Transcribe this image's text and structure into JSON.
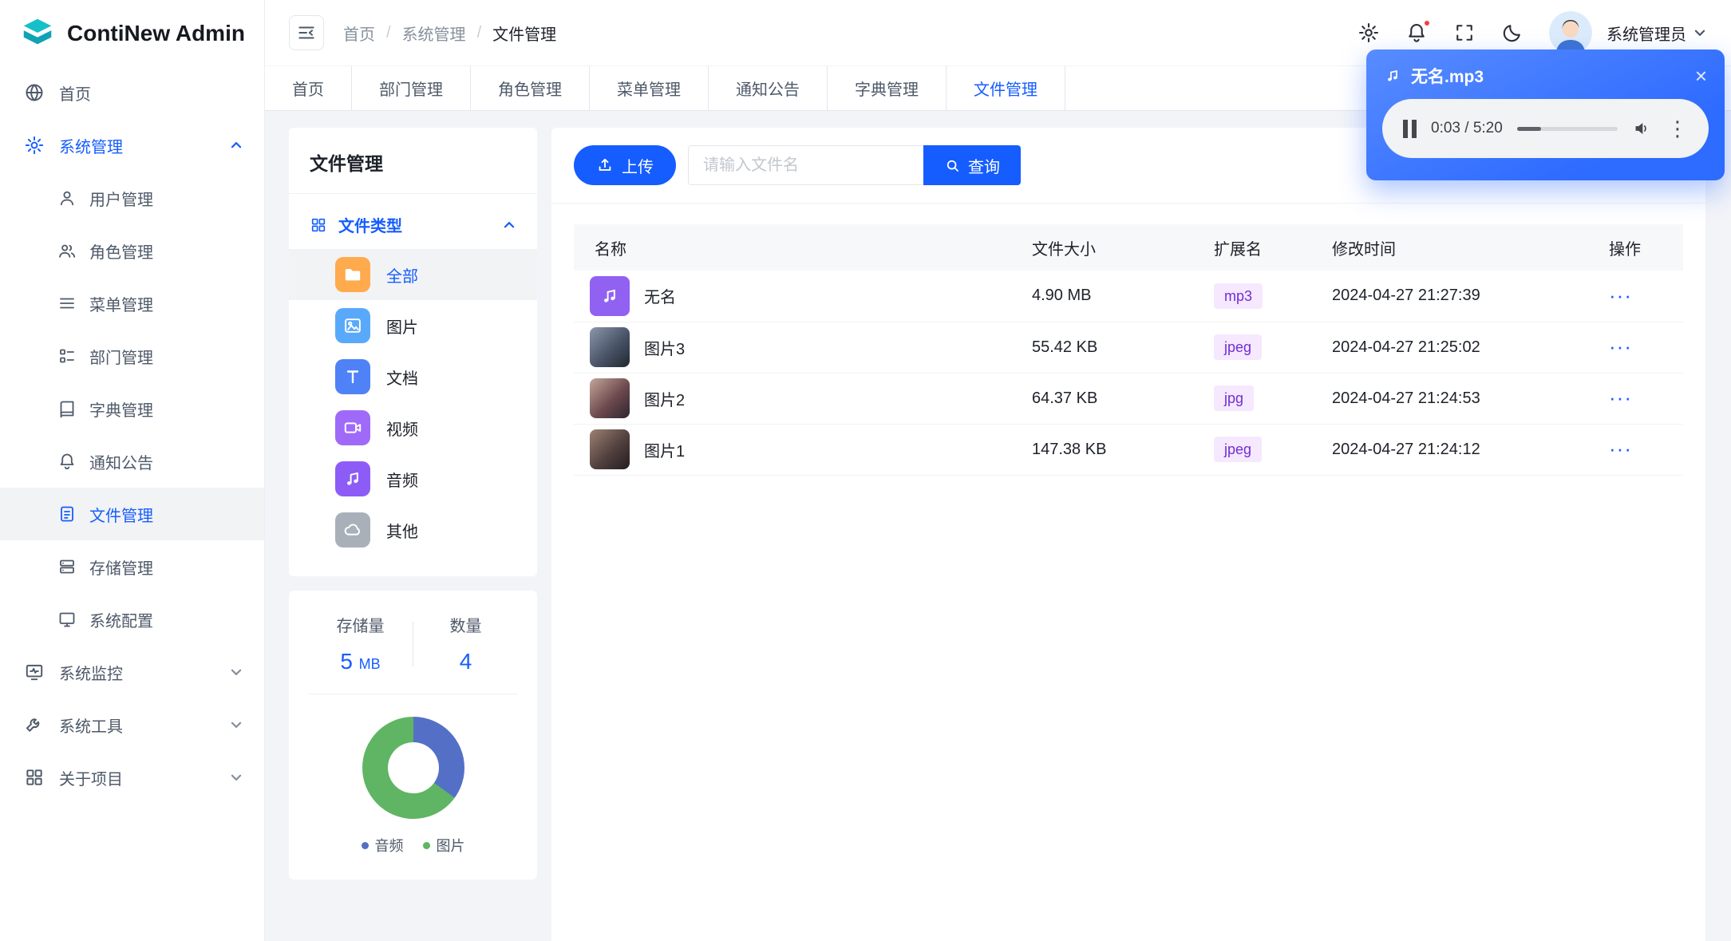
{
  "app": {
    "title": "ContiNew Admin"
  },
  "header": {
    "breadcrumb": {
      "items": [
        "首页",
        "系统管理",
        "文件管理"
      ],
      "separator": "/"
    },
    "user": {
      "name": "系统管理员"
    }
  },
  "tabs": {
    "items": [
      "首页",
      "部门管理",
      "角色管理",
      "菜单管理",
      "通知公告",
      "字典管理",
      "文件管理"
    ],
    "active": "文件管理"
  },
  "sidebar": {
    "home": "首页",
    "system": "系统管理",
    "system_children": [
      "用户管理",
      "角色管理",
      "菜单管理",
      "部门管理",
      "字典管理",
      "通知公告",
      "文件管理",
      "存储管理",
      "系统配置"
    ],
    "active_child": "文件管理",
    "monitor": "系统监控",
    "tools": "系统工具",
    "about": "关于项目"
  },
  "file_panel": {
    "title": "文件管理",
    "group_label": "文件类型",
    "types": [
      "全部",
      "图片",
      "文档",
      "视频",
      "音频",
      "其他"
    ],
    "active_type": "全部",
    "stats": {
      "storage_label": "存储量",
      "storage_value": "5",
      "storage_unit": "MB",
      "count_label": "数量",
      "count_value": "4"
    }
  },
  "chart": {
    "type": "pie",
    "title": "",
    "segments": [
      {
        "label": "音频",
        "color": "#5470c6",
        "percent": 35
      },
      {
        "label": "图片",
        "color": "#5fb563",
        "percent": 65
      }
    ]
  },
  "toolbar": {
    "upload_label": "上传",
    "search_placeholder": "请输入文件名",
    "query_label": "查询"
  },
  "table": {
    "headers": [
      "名称",
      "文件大小",
      "扩展名",
      "修改时间",
      "操作"
    ],
    "more_glyph": "···",
    "rows": [
      {
        "name": "无名",
        "size": "4.90 MB",
        "ext": "mp3",
        "time": "2024-04-27 21:27:39",
        "type": "audio"
      },
      {
        "name": "图片3",
        "size": "55.42 KB",
        "ext": "jpeg",
        "time": "2024-04-27 21:25:02",
        "type": "image"
      },
      {
        "name": "图片2",
        "size": "64.37 KB",
        "ext": "jpg",
        "time": "2024-04-27 21:24:53",
        "type": "image"
      },
      {
        "name": "图片1",
        "size": "147.38 KB",
        "ext": "jpeg",
        "time": "2024-04-27 21:24:12",
        "type": "image"
      }
    ]
  },
  "player": {
    "title": "无名.mp3",
    "time": "0:03 / 5:20",
    "close_glyph": "×"
  },
  "colors": {
    "primary": "#165dff",
    "badge_bg": "#f5e8ff",
    "badge_text": "#722ed1"
  }
}
